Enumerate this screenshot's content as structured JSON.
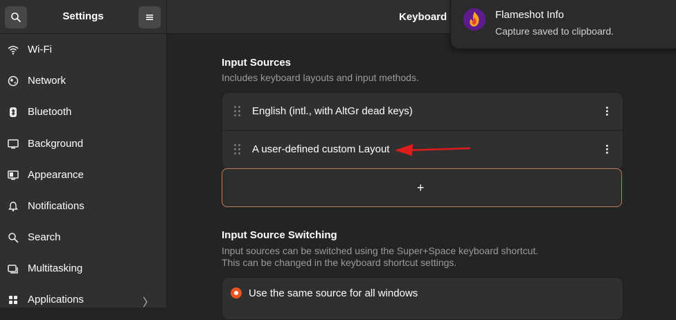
{
  "sidebar": {
    "title": "Settings",
    "items": [
      {
        "label": "Wi-Fi",
        "icon": "wifi-icon"
      },
      {
        "label": "Network",
        "icon": "network-icon"
      },
      {
        "label": "Bluetooth",
        "icon": "bluetooth-icon"
      },
      {
        "label": "Background",
        "icon": "background-icon"
      },
      {
        "label": "Appearance",
        "icon": "appearance-icon"
      },
      {
        "label": "Notifications",
        "icon": "bell-icon"
      },
      {
        "label": "Search",
        "icon": "search-icon"
      },
      {
        "label": "Multitasking",
        "icon": "multitasking-icon"
      },
      {
        "label": "Applications",
        "icon": "applications-icon",
        "chevron": "〉"
      }
    ]
  },
  "header": {
    "title": "Keyboard"
  },
  "input_sources": {
    "title": "Input Sources",
    "subtitle": "Includes keyboard layouts and input methods.",
    "rows": [
      {
        "label": "English (intl., with AltGr dead keys)"
      },
      {
        "label": "A user-defined custom Layout"
      }
    ],
    "add_label": "+"
  },
  "switching": {
    "title": "Input Source Switching",
    "subtitle_line1": "Input sources can be switched using the Super+Space keyboard shortcut.",
    "subtitle_line2": "This can be changed in the keyboard shortcut settings.",
    "option_label": "Use the same source for all windows"
  },
  "notification": {
    "title": "Flameshot Info",
    "body": "Capture saved to clipboard.",
    "icon": "flameshot-icon"
  },
  "colors": {
    "accent": "#e95420",
    "annotation_arrow": "#e01b1b",
    "window_bg": "#242424",
    "sidebar_bg": "#303030"
  }
}
